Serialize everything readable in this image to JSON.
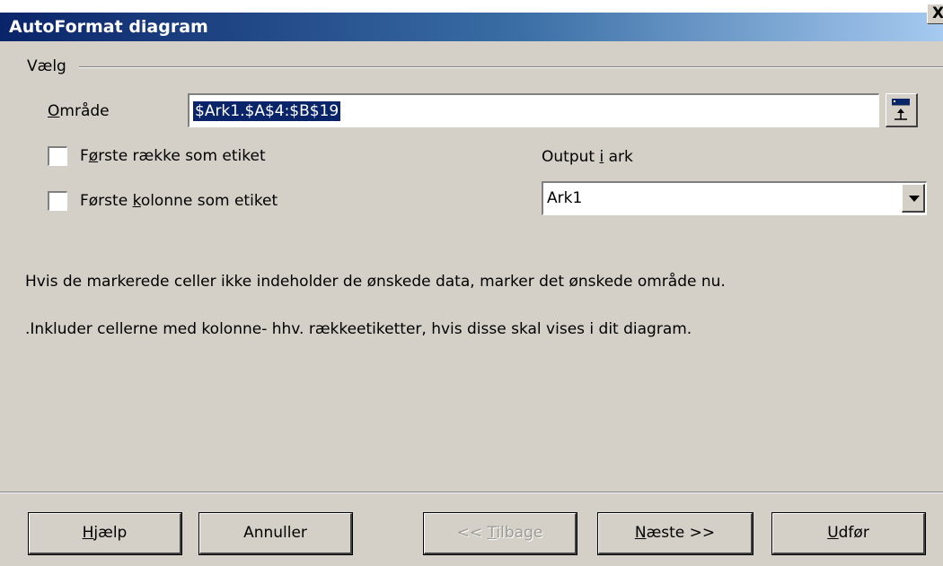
{
  "window": {
    "title": "AutoFormat diagram",
    "close_glyph": "X"
  },
  "group": {
    "label": "Vælg"
  },
  "range": {
    "label_prefix": "O",
    "label_rest": "mråde",
    "value": "$Ark1.$A$4:$B$19"
  },
  "checkboxes": {
    "first_row": {
      "pre": "F",
      "ul": "ø",
      "post": "rste række som etiket",
      "checked": false
    },
    "first_col": {
      "pre": "Første ",
      "ul": "k",
      "post": "olonne som etiket",
      "checked": false
    }
  },
  "output": {
    "label_pre": "Output ",
    "label_ul": "i",
    "label_post": " ark",
    "value": "Ark1"
  },
  "info": {
    "line1": "Hvis de markerede celler ikke indeholder de ønskede data, marker det ønskede område nu.",
    "line2": ".Inkluder cellerne med kolonne- hhv. rækkeetiketter, hvis disse skal vises i dit diagram."
  },
  "buttons": {
    "help": {
      "ul": "H",
      "rest": "jælp"
    },
    "cancel": {
      "label": "Annuller"
    },
    "back": {
      "pre": "<< ",
      "ul": "T",
      "post": "ilbage"
    },
    "next": {
      "ul": "N",
      "rest": "æste >>"
    },
    "finish": {
      "ul": "U",
      "rest": "dfør"
    }
  }
}
